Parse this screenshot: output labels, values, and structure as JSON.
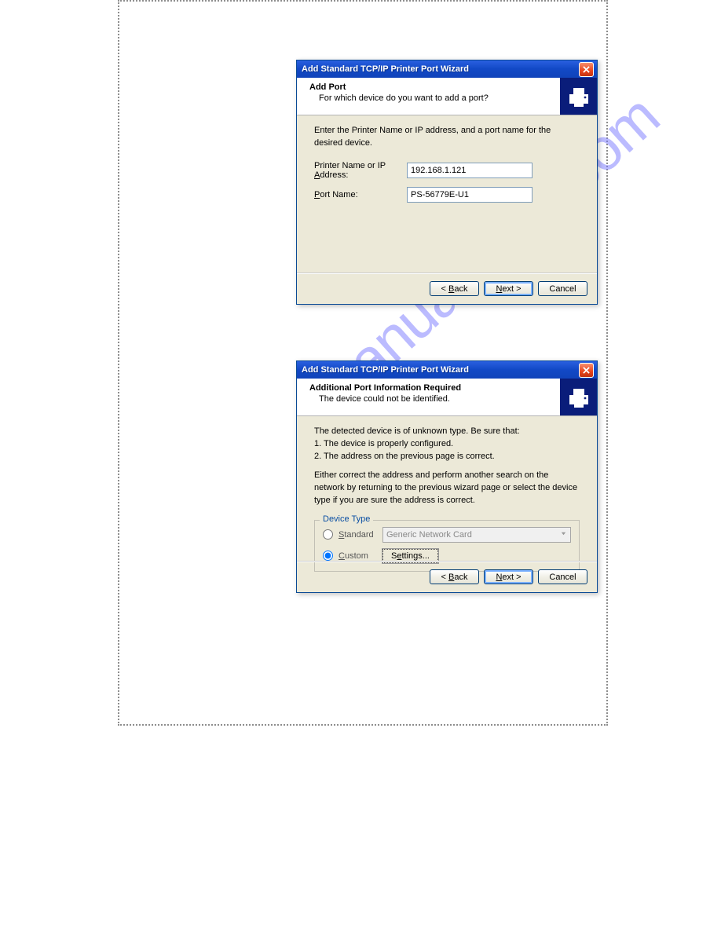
{
  "watermark": "manualshive.com",
  "dialog1": {
    "title": "Add Standard TCP/IP Printer Port Wizard",
    "header_title": "Add Port",
    "header_sub": "For which device do you want to add a port?",
    "intro": "Enter the Printer Name or IP address, and a port name for the desired device.",
    "label_ip_pre": "Printer Name or IP ",
    "label_ip_under": "A",
    "label_ip_post": "ddress:",
    "label_port_under": "P",
    "label_port_post": "ort Name:",
    "value_ip": "192.168.1.121",
    "value_port": "PS-56779E-U1",
    "btn_back_pre": "< ",
    "btn_back_under": "B",
    "btn_back_post": "ack",
    "btn_next_under": "N",
    "btn_next_post": "ext >",
    "btn_cancel": "Cancel"
  },
  "dialog2": {
    "title": "Add Standard TCP/IP Printer Port Wizard",
    "header_title": "Additional Port Information Required",
    "header_sub": "The device could not be identified.",
    "para1": "The detected device is of unknown type.  Be sure that:",
    "para1_l1": "1.  The device is properly configured.",
    "para1_l2": "2.  The address on the previous page is correct.",
    "para2": "Either correct the address and perform another search on the network by returning to the previous wizard page or select the device type if you are sure the address is correct.",
    "fieldset_legend": "Device Type",
    "radio_standard_under": "S",
    "radio_standard_post": "tandard",
    "radio_custom_under": "C",
    "radio_custom_post": "ustom",
    "dropdown_value": "Generic Network Card",
    "btn_settings_pre": "S",
    "btn_settings_under": "e",
    "btn_settings_post": "ttings...",
    "btn_back_pre": "< ",
    "btn_back_under": "B",
    "btn_back_post": "ack",
    "btn_next_under": "N",
    "btn_next_post": "ext >",
    "btn_cancel": "Cancel"
  }
}
